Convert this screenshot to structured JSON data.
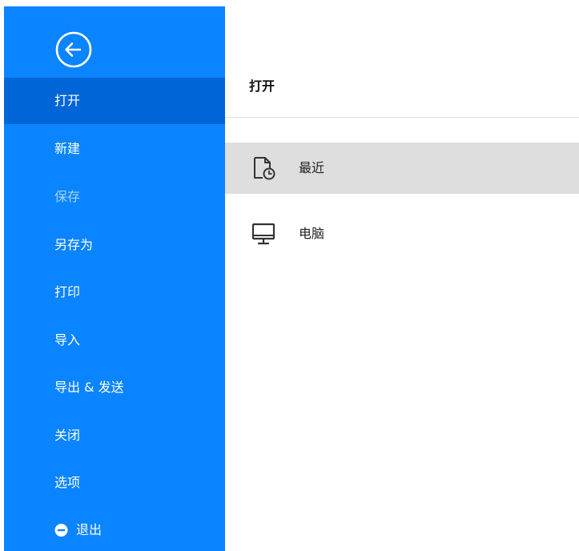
{
  "sidebar": {
    "back_icon": "arrow-left-circle-icon",
    "background_color": "#0a84ff",
    "active_color": "#0065d6",
    "items": [
      {
        "label": "打开",
        "state": "active"
      },
      {
        "label": "新建",
        "state": "normal"
      },
      {
        "label": "保存",
        "state": "disabled"
      },
      {
        "label": "另存为",
        "state": "normal"
      },
      {
        "label": "打印",
        "state": "normal"
      },
      {
        "label": "导入",
        "state": "normal"
      },
      {
        "label": "导出 & 发送",
        "state": "normal"
      },
      {
        "label": "关闭",
        "state": "normal"
      },
      {
        "label": "选项",
        "state": "normal"
      },
      {
        "label": "退出",
        "state": "normal",
        "icon": "minus-circle-icon"
      }
    ]
  },
  "main": {
    "title": "打开",
    "locations": [
      {
        "label": "最近",
        "icon": "recent-document-clock-icon",
        "selected": true
      },
      {
        "label": "电脑",
        "icon": "monitor-icon",
        "selected": false
      }
    ],
    "selected_color": "#dedede"
  }
}
